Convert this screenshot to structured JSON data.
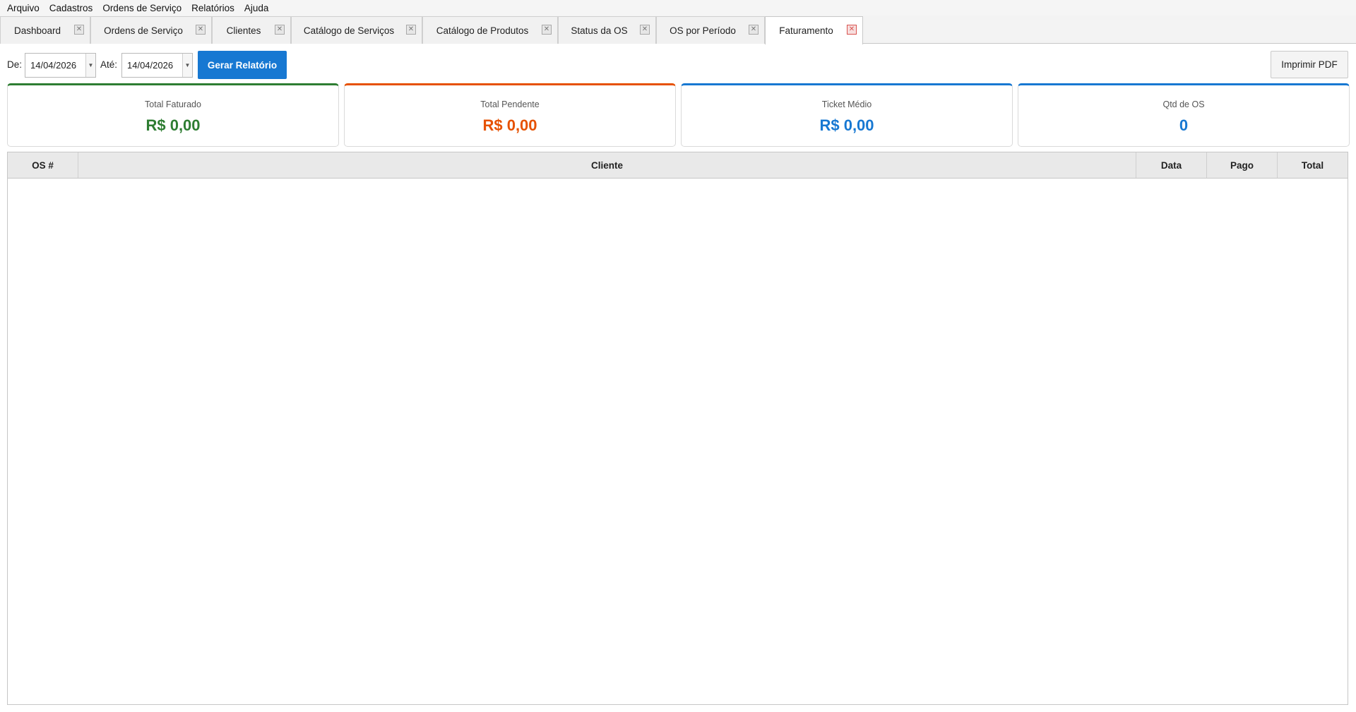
{
  "menu": {
    "items": [
      "Arquivo",
      "Cadastros",
      "Ordens de Serviço",
      "Relatórios",
      "Ajuda"
    ]
  },
  "tabs": [
    {
      "label": "Dashboard",
      "active": false
    },
    {
      "label": "Ordens de Serviço",
      "active": false
    },
    {
      "label": "Clientes",
      "active": false
    },
    {
      "label": "Catálogo de Serviços",
      "active": false
    },
    {
      "label": "Catálogo de Produtos",
      "active": false
    },
    {
      "label": "Status da OS",
      "active": false
    },
    {
      "label": "OS por Período",
      "active": false
    },
    {
      "label": "Faturamento",
      "active": true
    }
  ],
  "tab_close_glyph": "✕",
  "filters": {
    "from_label": "De:",
    "from_value": "14/04/2026",
    "to_label": "Até:",
    "to_value": "14/04/2026",
    "generate_label": "Gerar Relatório",
    "print_label": "Imprimir PDF"
  },
  "cards": [
    {
      "label": "Total Faturado",
      "value": "R$ 0,00",
      "color": "#2e7d32"
    },
    {
      "label": "Total Pendente",
      "value": "R$ 0,00",
      "color": "#e65100"
    },
    {
      "label": "Ticket Médio",
      "value": "R$ 0,00",
      "color": "#1778d2"
    },
    {
      "label": "Qtd de OS",
      "value": "0",
      "color": "#1778d2"
    }
  ],
  "table": {
    "columns": [
      "OS #",
      "Cliente",
      "Data",
      "Pago",
      "Total"
    ],
    "rows": []
  },
  "colors": {
    "primary": "#1778d2",
    "success": "#2e7d32",
    "warning": "#e65100"
  }
}
